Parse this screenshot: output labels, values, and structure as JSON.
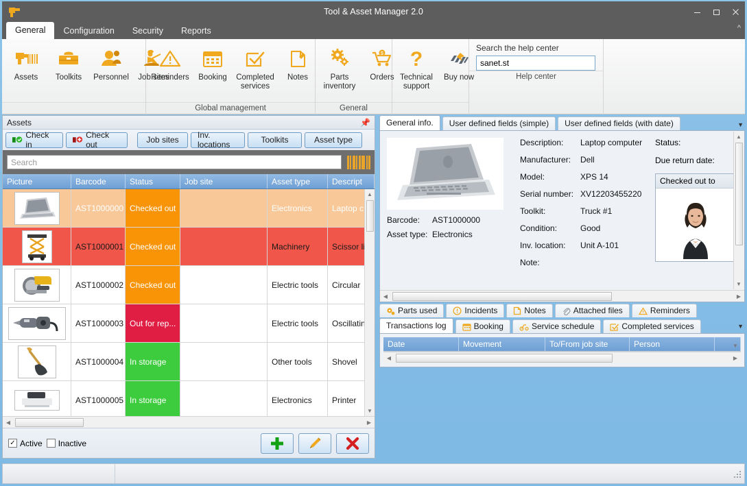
{
  "window": {
    "title": "Tool & Asset Manager 2.0",
    "logo_icon": "drill-icon",
    "minimize_icon": "minimize-icon",
    "maximize_icon": "maximize-icon",
    "close_icon": "close-icon"
  },
  "ribbon": {
    "tabs": [
      {
        "label": "General",
        "active": true
      },
      {
        "label": "Configuration",
        "active": false
      },
      {
        "label": "Security",
        "active": false
      },
      {
        "label": "Reports",
        "active": false
      }
    ],
    "collapse_icon": "chevron-up-icon",
    "groups": [
      {
        "label": "",
        "buttons": [
          {
            "label": "Assets",
            "icon": "drill-barcode-icon"
          },
          {
            "label": "Toolkits",
            "icon": "toolbox-icon"
          },
          {
            "label": "Personnel",
            "icon": "person-icon"
          },
          {
            "label": "Job sites",
            "icon": "worker-icon"
          }
        ]
      },
      {
        "label": "Global management",
        "buttons": [
          {
            "label": "Reminders",
            "icon": "warning-triangle-icon"
          },
          {
            "label": "Booking",
            "icon": "calendar-icon"
          },
          {
            "label": "Completed services",
            "icon": "checkbox-check-icon"
          },
          {
            "label": "Notes",
            "icon": "note-pencil-icon"
          }
        ]
      },
      {
        "label": "General",
        "buttons": [
          {
            "label": "Parts inventory",
            "icon": "gears-icon"
          },
          {
            "label": "Orders",
            "icon": "shopping-cart-icon"
          }
        ]
      },
      {
        "label": "",
        "buttons": [
          {
            "label": "Technical support",
            "icon": "question-mark-icon"
          },
          {
            "label": "Buy now",
            "icon": "buy-now-icon"
          }
        ]
      }
    ],
    "help": {
      "group_label": "Help center",
      "label": "Search the help center",
      "value": "sanet.st",
      "placeholder": ""
    }
  },
  "assets_panel": {
    "title": "Assets",
    "pin_icon": "pin-icon",
    "buttons": [
      {
        "label": "Check in",
        "icon": "check-in-icon"
      },
      {
        "label": "Check out",
        "icon": "check-out-icon"
      },
      {
        "label": "Job sites",
        "icon": ""
      },
      {
        "label": "Inv. locations",
        "icon": ""
      },
      {
        "label": "Toolkits",
        "icon": ""
      },
      {
        "label": "Asset type",
        "icon": ""
      }
    ],
    "search_placeholder": "Search",
    "search_value": "",
    "barcode_icon": "barcode-icon",
    "columns": [
      "Picture",
      "Barcode",
      "Status",
      "Job site",
      "Asset type",
      "Descript"
    ],
    "rows": [
      {
        "picture": "laptop-thumb",
        "barcode": "AST1000000",
        "status": "Checked out",
        "job_site": "",
        "asset_type": "Electronics",
        "description": "Laptop c",
        "row_style": "selected",
        "status_color": "#f89406"
      },
      {
        "picture": "scissor-lift-thumb",
        "barcode": "AST1000001",
        "status": "Checked out",
        "job_site": "",
        "asset_type": "Machinery",
        "description": "Scissor li",
        "row_style": "overdue",
        "status_color": "#f89406"
      },
      {
        "picture": "circular-saw-thumb",
        "barcode": "AST1000002",
        "status": "Checked out",
        "job_site": "",
        "asset_type": "Electric tools",
        "description": "Circular",
        "row_style": "normal",
        "status_color": "#f89406"
      },
      {
        "picture": "oscillating-tool-thumb",
        "barcode": "AST1000003",
        "status": "Out for rep...",
        "job_site": "",
        "asset_type": "Electric tools",
        "description": "Oscillatin",
        "row_style": "normal",
        "status_color": "#e01e43"
      },
      {
        "picture": "shovel-thumb",
        "barcode": "AST1000004",
        "status": "In storage",
        "job_site": "",
        "asset_type": "Other tools",
        "description": "Shovel",
        "row_style": "normal",
        "status_color": "#3dcc3d"
      },
      {
        "picture": "printer-thumb",
        "barcode": "AST1000005",
        "status": "In storage",
        "job_site": "",
        "asset_type": "Electronics",
        "description": "Printer",
        "row_style": "normal",
        "status_color": "#3dcc3d"
      }
    ],
    "filters": [
      {
        "label": "Active",
        "checked": true
      },
      {
        "label": "Inactive",
        "checked": false
      }
    ],
    "actions": [
      {
        "name": "add",
        "icon": "plus-icon",
        "color": "#12a112"
      },
      {
        "name": "edit",
        "icon": "pencil-icon",
        "color": "#f0a81e"
      },
      {
        "name": "delete",
        "icon": "x-icon",
        "color": "#d42020"
      }
    ]
  },
  "detail_panel": {
    "tabs": [
      {
        "label": "General info.",
        "active": true
      },
      {
        "label": "User defined fields (simple)",
        "active": false
      },
      {
        "label": "User defined fields (with date)",
        "active": false
      }
    ],
    "caret_icon": "chevron-down-icon",
    "photo_icon": "laptop-photo",
    "left_fields": [
      {
        "key": "Barcode:",
        "value": "AST1000000"
      },
      {
        "key": "Asset type:",
        "value": "Electronics"
      }
    ],
    "fields": [
      {
        "key": "Description:",
        "value": "Laptop computer"
      },
      {
        "key": "Manufacturer:",
        "value": "Dell"
      },
      {
        "key": "Model:",
        "value": "XPS 14"
      },
      {
        "key": "Serial number:",
        "value": "XV12203455220"
      },
      {
        "key": "Toolkit:",
        "value": "Truck #1"
      },
      {
        "key": "Condition:",
        "value": "Good"
      },
      {
        "key": "Inv. location:",
        "value": "Unit A-101"
      },
      {
        "key": "Note:",
        "value": ""
      }
    ],
    "right_fields": [
      {
        "key": "Status:",
        "value": ""
      },
      {
        "key": "Due return date:",
        "value": ""
      }
    ],
    "checked_out_to": {
      "label": "Checked out to",
      "photo_icon": "person-photo"
    }
  },
  "lower_panel": {
    "tabs_row1": [
      {
        "label": "Parts used",
        "icon": "gears-small-icon",
        "active": false
      },
      {
        "label": "Incidents",
        "icon": "alert-circle-icon",
        "active": false
      },
      {
        "label": "Notes",
        "icon": "note-icon",
        "active": false
      },
      {
        "label": "Attached files",
        "icon": "paperclip-icon",
        "active": false
      },
      {
        "label": "Reminders",
        "icon": "warning-small-icon",
        "active": false
      }
    ],
    "tabs_row2": [
      {
        "label": "Transactions log",
        "icon": "",
        "active": true
      },
      {
        "label": "Booking",
        "icon": "calendar-small-icon",
        "active": false
      },
      {
        "label": "Service schedule",
        "icon": "service-icon",
        "active": false
      },
      {
        "label": "Completed services",
        "icon": "check-small-icon",
        "active": false
      }
    ],
    "caret_icon": "chevron-down-icon",
    "log_columns": [
      "Date",
      "Movement",
      "To/From job site",
      "Person"
    ],
    "log_rows": []
  },
  "statusbar": {
    "left_text": "",
    "right_text": "",
    "grip_icon": "resize-grip-icon"
  }
}
